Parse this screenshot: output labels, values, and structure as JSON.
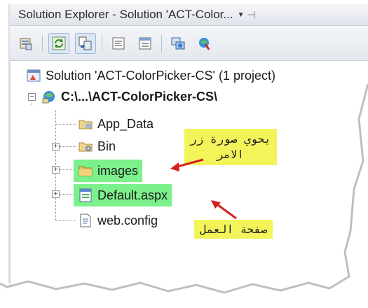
{
  "window": {
    "title": "Solution Explorer - Solution 'ACT-Color...",
    "title_dropdown_icon": "chevron-down-icon",
    "pin_icon": "pin-icon"
  },
  "toolbar": {
    "buttons": [
      {
        "name": "properties-button",
        "icon": "properties-icon"
      },
      {
        "name": "refresh-button",
        "icon": "refresh-icon"
      },
      {
        "name": "nest-related-files-button",
        "icon": "nest-files-icon"
      },
      {
        "name": "view-code-button",
        "icon": "view-code-icon"
      },
      {
        "name": "view-designer-button",
        "icon": "view-designer-icon"
      },
      {
        "name": "copy-website-button",
        "icon": "copy-website-icon"
      },
      {
        "name": "asp-net-configuration-button",
        "icon": "asp-net-config-icon"
      }
    ]
  },
  "tree": {
    "solution": "Solution 'ACT-ColorPicker-CS' (1 project)",
    "project": "C:\\...\\ACT-ColorPicker-CS\\",
    "items": [
      {
        "label": "App_Data",
        "icon": "folder-data-icon"
      },
      {
        "label": "Bin",
        "icon": "folder-bin-icon"
      },
      {
        "label": "images",
        "icon": "folder-icon"
      },
      {
        "label": "Default.aspx",
        "icon": "aspx-file-icon"
      },
      {
        "label": "web.config",
        "icon": "config-file-icon"
      }
    ]
  },
  "annotations": {
    "images_note_line1": "يحوي صورة زر",
    "images_note_line2": "الامر",
    "default_note": "صفحة العمل",
    "highlight_color": "#7cf08a",
    "note_color": "#f3f35a",
    "arrow_color": "#d42020"
  }
}
